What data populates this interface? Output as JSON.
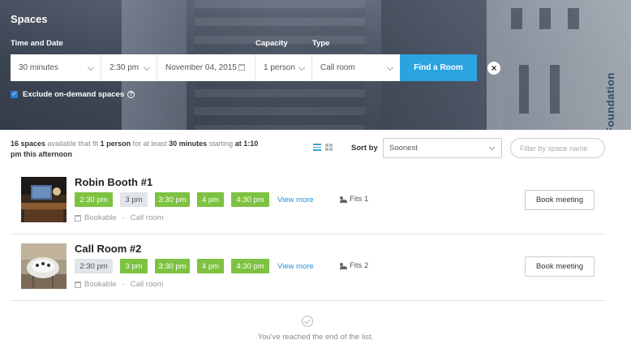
{
  "header": {
    "title": "Spaces",
    "time_date_label": "Time and Date",
    "capacity_label": "Capacity",
    "type_label": "Type",
    "background_text": "Foundation"
  },
  "search": {
    "duration": "30 minutes",
    "time": "2:30 pm",
    "date": "November 04, 2015",
    "capacity": "1 person",
    "type": "Call room",
    "find_button": "Find a Room",
    "exclude_label": "Exclude on-demand spaces"
  },
  "summary": {
    "count": "16 spaces",
    "t1": " available that fit ",
    "fit": "1 person",
    "t2": " for at least ",
    "duration": "30 minutes",
    "t3": " starting ",
    "start": "at 1:10 pm this afternoon"
  },
  "toolbar": {
    "sort_label": "Sort by",
    "sort_value": "Soonest",
    "filter_placeholder": "Filter by space name"
  },
  "rooms": [
    {
      "name": "Robin Booth #1",
      "slots": [
        {
          "label": "2:30 pm",
          "available": true
        },
        {
          "label": "3 pm",
          "available": false
        },
        {
          "label": "3:30 pm",
          "available": true
        },
        {
          "label": "4 pm",
          "available": true
        },
        {
          "label": "4:30 pm",
          "available": true
        }
      ],
      "view_more": "View more",
      "fits": "Fits 1",
      "bookable": "Bookable",
      "room_type": "Call room",
      "book_label": "Book meeting"
    },
    {
      "name": "Call Room #2",
      "slots": [
        {
          "label": "2:30 pm",
          "available": false
        },
        {
          "label": "3 pm",
          "available": true
        },
        {
          "label": "3:30 pm",
          "available": true
        },
        {
          "label": "4 pm",
          "available": true
        },
        {
          "label": "4:30 pm",
          "available": true
        }
      ],
      "view_more": "View more",
      "fits": "Fits 2",
      "bookable": "Bookable",
      "room_type": "Call room",
      "book_label": "Book meeting"
    }
  ],
  "end_message": "You've reached the end of the list.",
  "colors": {
    "accent": "#2ba3e0",
    "available": "#7dc241",
    "unavailable": "#e1e4e8",
    "link": "#2b8fd4"
  }
}
